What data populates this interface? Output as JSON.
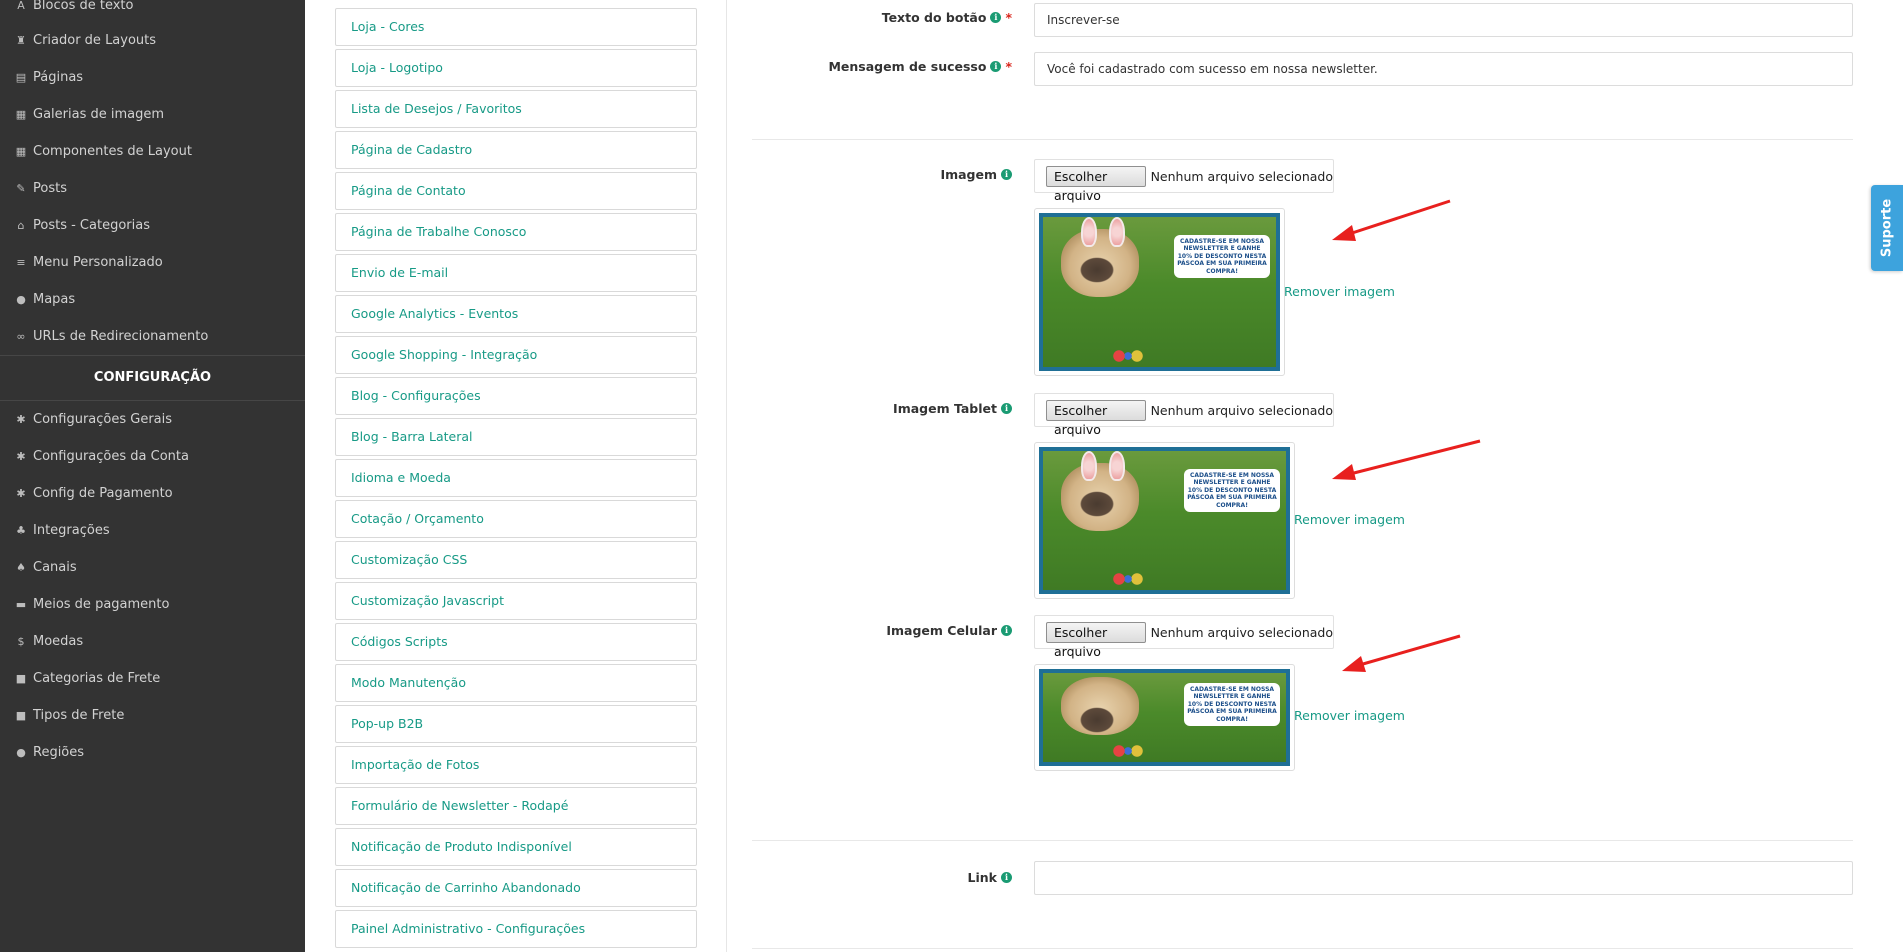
{
  "sidebar": {
    "items": [
      {
        "icon": "text-blocks-icon",
        "glyph": "A",
        "label": "Blocos de texto"
      },
      {
        "icon": "layout-builder-icon",
        "glyph": "♜",
        "label": "Criador de Layouts"
      },
      {
        "icon": "pages-icon",
        "glyph": "▤",
        "label": "Páginas"
      },
      {
        "icon": "image-gallery-icon",
        "glyph": "▦",
        "label": "Galerias de imagem"
      },
      {
        "icon": "layout-components-icon",
        "glyph": "▦",
        "label": "Componentes de Layout"
      },
      {
        "icon": "pushpin-icon",
        "glyph": "✎",
        "label": "Posts"
      },
      {
        "icon": "home-icon",
        "glyph": "⌂",
        "label": "Posts - Categorias"
      },
      {
        "icon": "menu-list-icon",
        "glyph": "≡",
        "label": "Menu Personalizado"
      },
      {
        "icon": "map-marker-icon",
        "glyph": "●",
        "label": "Mapas"
      },
      {
        "icon": "link-icon",
        "glyph": "∞",
        "label": "URLs de Redirecionamento"
      }
    ],
    "config_heading": "CONFIGURAÇÃO",
    "config_items": [
      {
        "icon": "gear-icon",
        "glyph": "✱",
        "label": "Configurações Gerais"
      },
      {
        "icon": "gear-icon",
        "glyph": "✱",
        "label": "Configurações da Conta"
      },
      {
        "icon": "gear-icon",
        "glyph": "✱",
        "label": "Config de Pagamento"
      },
      {
        "icon": "integrations-icon",
        "glyph": "♣",
        "label": "Integrações"
      },
      {
        "icon": "channels-icon",
        "glyph": "♠",
        "label": "Canais"
      },
      {
        "icon": "credit-card-icon",
        "glyph": "▬",
        "label": "Meios de pagamento"
      },
      {
        "icon": "dollar-icon",
        "glyph": "$",
        "label": "Moedas"
      },
      {
        "icon": "truck-icon",
        "glyph": "■",
        "label": "Categorias de Frete"
      },
      {
        "icon": "truck-icon",
        "glyph": "■",
        "label": "Tipos de Frete"
      },
      {
        "icon": "globe-icon",
        "glyph": "●",
        "label": "Regiões"
      }
    ]
  },
  "settings_list": [
    "Loja - Cores",
    "Loja - Logotipo",
    "Lista de Desejos / Favoritos",
    "Página de Cadastro",
    "Página de Contato",
    "Página de Trabalhe Conosco",
    "Envio de E-mail",
    "Google Analytics - Eventos",
    "Google Shopping - Integração",
    "Blog - Configurações",
    "Blog - Barra Lateral",
    "Idioma e Moeda",
    "Cotação / Orçamento",
    "Customização CSS",
    "Customização Javascript",
    "Códigos Scripts",
    "Modo Manutenção",
    "Pop-up B2B",
    "Importação de Fotos",
    "Formulário de Newsletter - Rodapé",
    "Notificação de Produto Indisponível",
    "Notificação de Carrinho Abandonado",
    "Painel Administrativo - Configurações"
  ],
  "form": {
    "button_text": {
      "label": "Texto do botão",
      "required_mark": "*",
      "value": "Inscrever-se"
    },
    "success_message": {
      "label": "Mensagem de sucesso",
      "required_mark": "*",
      "value": "Você foi cadastrado com sucesso em nossa newsletter."
    },
    "image": {
      "label": "Imagem"
    },
    "image_tablet": {
      "label": "Imagem Tablet"
    },
    "image_mobile": {
      "label": "Imagem Celular"
    },
    "link": {
      "label": "Link",
      "value": ""
    },
    "file_button_label": "Escolher arquivo",
    "file_status": "Nenhum arquivo selecionado",
    "remove_label": "Remover imagem",
    "info_glyph": "i",
    "banner_text": "CADASTRE-SE EM NOSSA NEWSLETTER E GANHE 10% DE DESCONTO NESTA PÁSCOA EM SUA PRIMEIRA COMPRA!"
  },
  "support_tab": {
    "label": "Suporte"
  },
  "colors": {
    "sidebar_bg": "#333333",
    "link_teal": "#179a86",
    "info_green": "#1a9b73",
    "required_red": "#d9261c",
    "arrow_red": "#e8201e",
    "support_blue": "#3da3dd"
  }
}
